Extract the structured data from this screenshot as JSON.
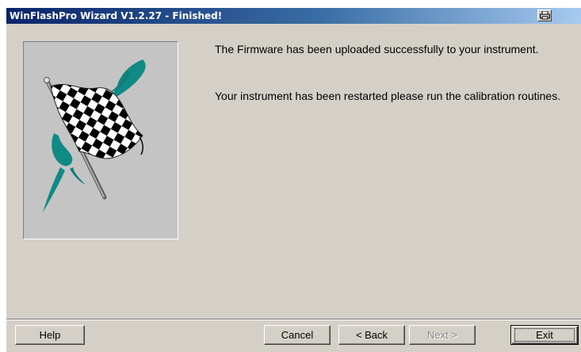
{
  "window": {
    "title": "WinFlashPro Wizard V1.2.27 - Finished!"
  },
  "titlebar_icons": {
    "system_menu": "printer-icon"
  },
  "content": {
    "image": "checkered-flag-icon",
    "message_1": "The Firmware has been uploaded successfully to your instrument.",
    "message_2": "Your instrument has been restarted please run the calibration routines."
  },
  "buttons": {
    "help": "Help",
    "cancel": "Cancel",
    "back": "< Back",
    "next": "Next >",
    "exit": "Exit",
    "next_disabled": true
  },
  "colors": {
    "titlebar_start": "#0a246a",
    "titlebar_end": "#a6caf0",
    "dialog_face": "#d4d0c8",
    "flag_teal": "#0f8a84"
  }
}
